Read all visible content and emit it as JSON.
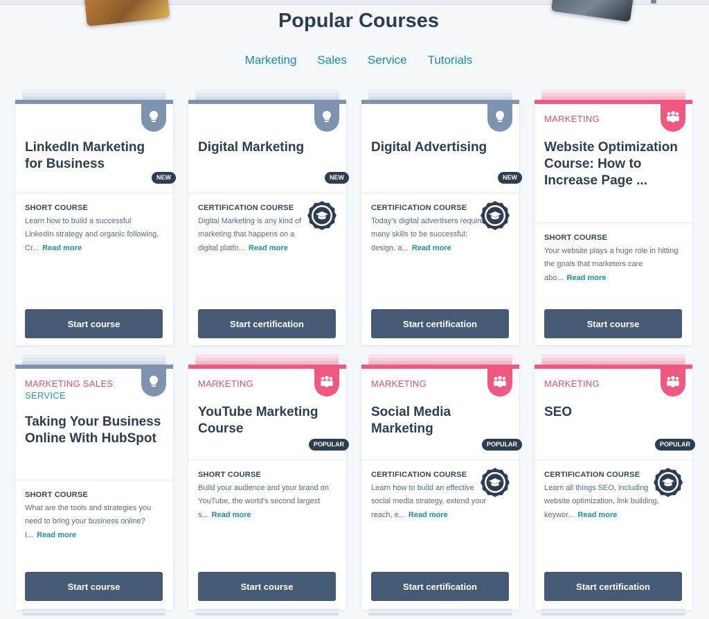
{
  "page": {
    "title": "Popular Courses"
  },
  "filters": [
    "Marketing",
    "Sales",
    "Service",
    "Tutorials"
  ],
  "labels": {
    "read_more": "Read more"
  },
  "colors": {
    "accent_blue": "#1b8ea3",
    "pink": "#f1577f",
    "slate": "#7e93ad",
    "button": "#455a74",
    "heading": "#2d3e50"
  },
  "courses": [
    {
      "title": "LinkedIn Marketing for Business",
      "tags": [],
      "badge": "NEW",
      "type": "SHORT COURSE",
      "description": "Learn how to build a successful LinkedIn strategy and organic following. Cr...",
      "button": "Start course",
      "icon": "lightbulb-icon",
      "certificate": false
    },
    {
      "title": "Digital Marketing",
      "tags": [],
      "badge": "NEW",
      "type": "CERTIFICATION COURSE",
      "description": "Digital Marketing is any kind of marketing that happens on a digital platfo...",
      "button": "Start certification",
      "icon": "lightbulb-icon",
      "certificate": true
    },
    {
      "title": "Digital Advertising",
      "tags": [],
      "badge": "NEW",
      "type": "CERTIFICATION COURSE",
      "description": "Today's digital advertisers require many skills to be successful: design, a...",
      "button": "Start certification",
      "icon": "lightbulb-icon",
      "certificate": true
    },
    {
      "title": "Website Optimization Course: How to Increase Page ...",
      "tags": [
        "MARKETING"
      ],
      "badge": "",
      "type": "SHORT COURSE",
      "description": "Your website plays a huge role in hitting the goals that marketers care abo...",
      "button": "Start course",
      "icon": "people-icon",
      "certificate": false
    },
    {
      "title": "Taking Your Business Online With HubSpot",
      "tags": [
        "MARKETING",
        "SALES",
        "SERVICE"
      ],
      "badge": "",
      "type": "SHORT COURSE",
      "description": "What are the tools and strategies you need to bring your business online? I...",
      "button": "Start course",
      "icon": "lightbulb-icon",
      "certificate": false
    },
    {
      "title": "YouTube Marketing Course",
      "tags": [
        "MARKETING"
      ],
      "badge": "POPULAR",
      "type": "SHORT COURSE",
      "description": "Build your audience and your brand on YouTube, the world's second largest s...",
      "button": "Start course",
      "icon": "people-icon",
      "certificate": false
    },
    {
      "title": "Social Media Marketing",
      "tags": [
        "MARKETING"
      ],
      "badge": "POPULAR",
      "type": "CERTIFICATION COURSE",
      "description": "Learn how to build an effective social media strategy, extend your reach, e...",
      "button": "Start certification",
      "icon": "people-icon",
      "certificate": true
    },
    {
      "title": "SEO",
      "tags": [
        "MARKETING"
      ],
      "badge": "POPULAR",
      "type": "CERTIFICATION COURSE",
      "description": "Learn all things SEO, including website optimization, link building, keywor...",
      "button": "Start certification",
      "icon": "people-icon",
      "certificate": true
    }
  ]
}
